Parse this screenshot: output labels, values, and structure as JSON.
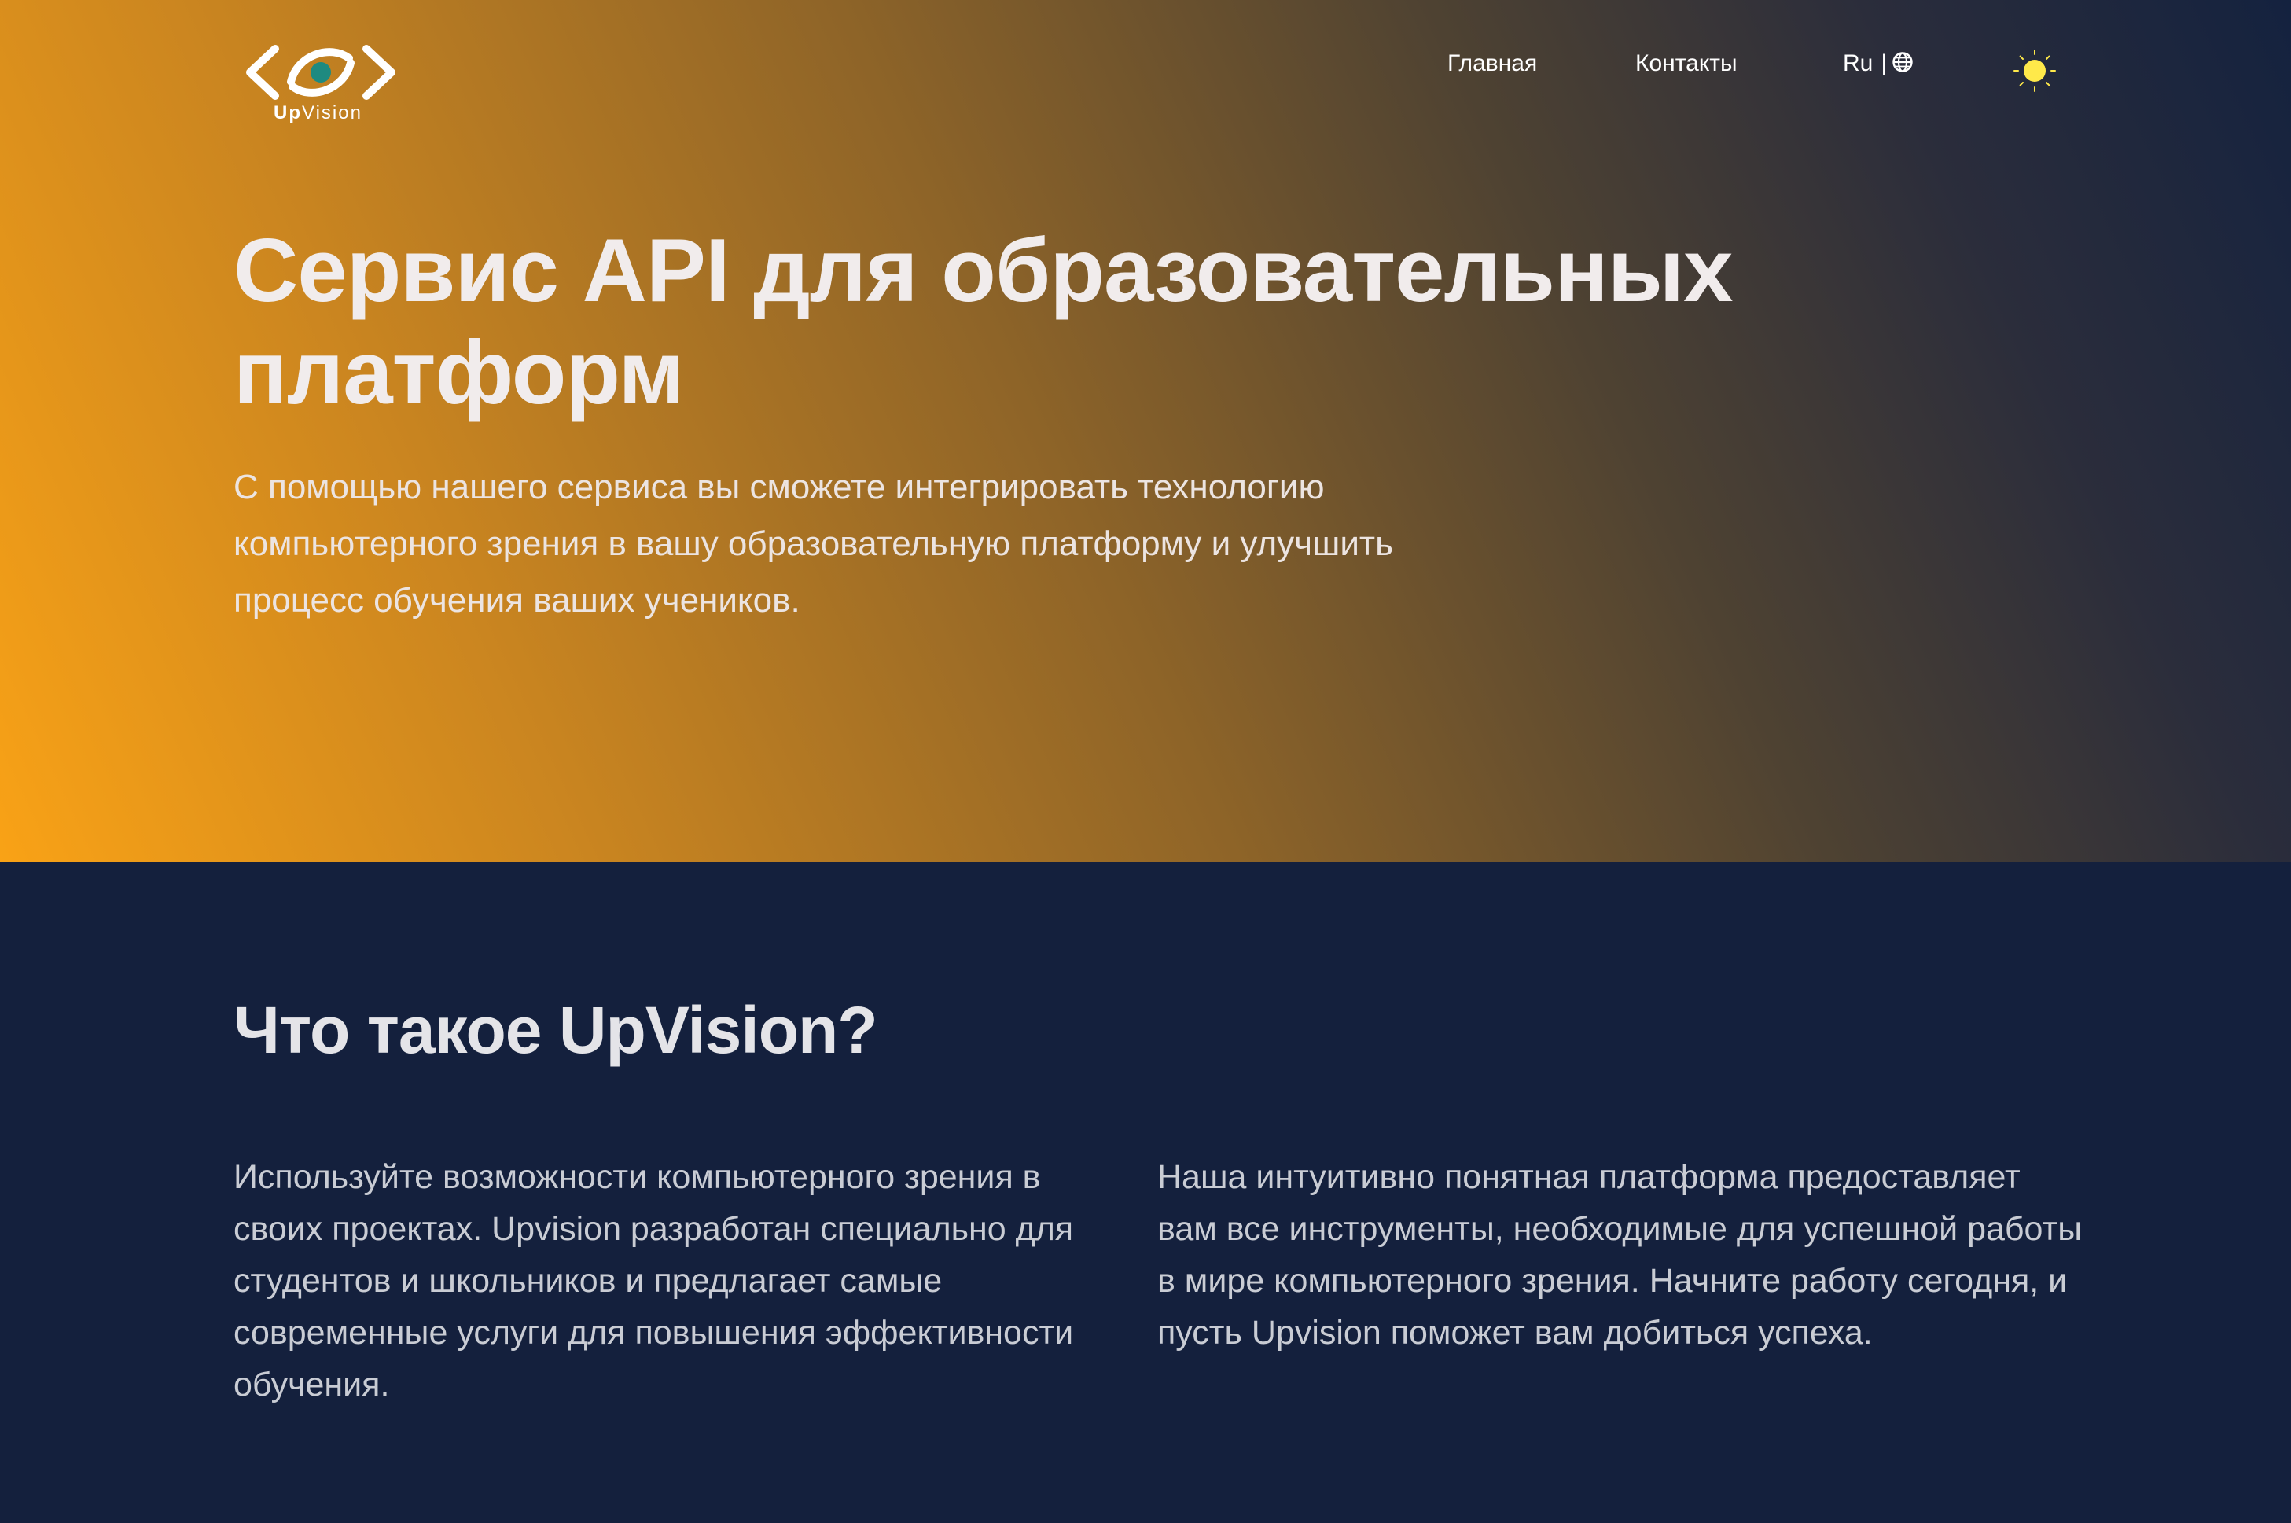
{
  "header": {
    "logo": {
      "name_bold": "Up",
      "name_regular": "Vision",
      "colors": {
        "outline": "#ffffff",
        "pupil": "#1e8a80"
      }
    },
    "nav": {
      "home_label": "Главная",
      "contacts_label": "Контакты",
      "language_label": "Ru",
      "language_separator": "|",
      "language_icon": "globe-icon"
    },
    "theme_toggle": {
      "icon": "sun-icon",
      "color": "#ffe94a"
    }
  },
  "hero": {
    "title": "Сервис API для образовательных платформ",
    "subtitle": "С помощью нашего сервиса вы сможете интегрировать технологию компьютерного зрения в вашу образовательную платформу и улучшить процесс обучения ваших учеников.",
    "gradient": {
      "from": "#f9a216",
      "via": "#8e6428",
      "to": "#14223f"
    }
  },
  "about": {
    "title": "Что такое UpVision?",
    "left_paragraph": "Используйте возможности компьютерного зрения в своих проектах. Upvision разработан специально для студентов и школьников и предлагает самые современные услуги для повышения эффективности обучения.",
    "right_paragraph": "Наша интуитивно понятная платформа предоставляет вам все инструменты, необходимые для успешной работы в мире компьютерного зрения. Начните работу сегодня, и пусть Upvision поможет вам добиться успеха.",
    "background": "#14203d"
  }
}
